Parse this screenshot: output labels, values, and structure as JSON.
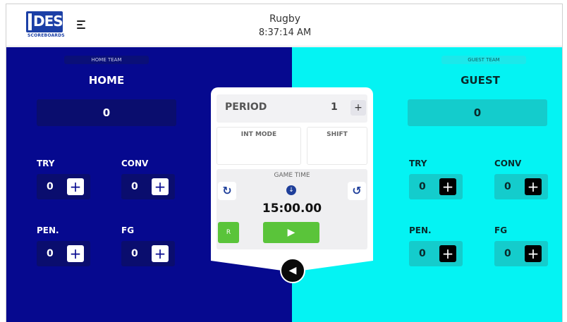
{
  "header": {
    "logo_text": "DES",
    "logo_subtext": "SCOREBOARDS",
    "title": "Rugby",
    "time": "8:37:14 AM"
  },
  "home": {
    "tag": "HOME TEAM",
    "name": "HOME",
    "score": "0",
    "stats": [
      {
        "label": "TRY",
        "value": "0"
      },
      {
        "label": "CONV",
        "value": "0"
      },
      {
        "label": "PEN.",
        "value": "0"
      },
      {
        "label": "FG",
        "value": "0"
      }
    ],
    "color": "#06098f"
  },
  "guest": {
    "tag": "GUEST TEAM",
    "name": "GUEST",
    "score": "0",
    "stats": [
      {
        "label": "TRY",
        "value": "0"
      },
      {
        "label": "CONV",
        "value": "0"
      },
      {
        "label": "PEN.",
        "value": "0"
      },
      {
        "label": "FG",
        "value": "0"
      }
    ],
    "color": "#04f3f3"
  },
  "control": {
    "period_label": "PERIOD",
    "period_value": "1",
    "period_plus": "+",
    "int_mode": "INT MODE",
    "shift": "SHIFT",
    "game_time_label": "GAME TIME",
    "game_time": "15:00.00",
    "reset_label": "R"
  },
  "icons": {
    "menu": "menu-icon",
    "refresh": "refresh-icon",
    "undo": "undo-icon",
    "down": "arrow-down-icon",
    "play": "play-icon",
    "horn": "horn-icon",
    "plus": "plus-icon"
  },
  "plus_symbol": "+"
}
